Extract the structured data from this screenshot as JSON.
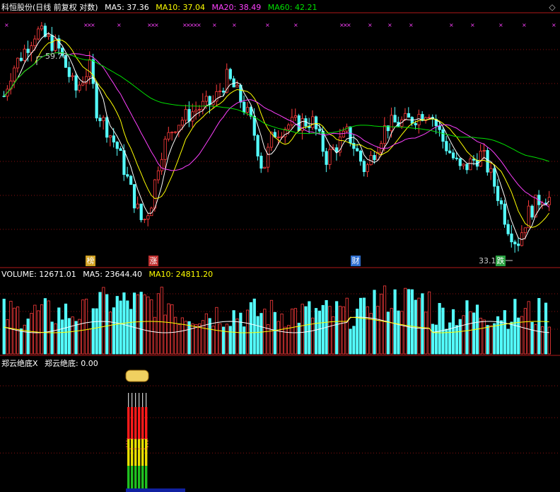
{
  "header": {
    "title": "科恒股份(日线 前复权 对数)",
    "ma5_label": "MA5: 37.36",
    "ma10_label": "MA10: 37.04",
    "ma20_label": "MA20: 38.49",
    "ma60_label": "MA60: 42.21"
  },
  "volume_header": {
    "volume_label": "VOLUME: 12671.01",
    "ma5_label": "MA5: 23644.40",
    "ma10_label": "MA10: 24811.20"
  },
  "indicator_header": {
    "name_label": "郑云绝底X",
    "value_label": "郑云绝底: 0.00"
  },
  "annotations": {
    "high_label": "59.70",
    "low_label": "33.10"
  },
  "events": [
    {
      "label": "榜",
      "color": "#d0a020"
    },
    {
      "label": "涨",
      "color": "#c03030"
    },
    {
      "label": "财",
      "color": "#2f6fd0"
    },
    {
      "label": "跌",
      "color": "#28a040"
    }
  ],
  "colors": {
    "up": "#ff3c3c",
    "down": "#54ffff",
    "ma5": "#ffffff",
    "ma10": "#ffff00",
    "ma20": "#ff40ff",
    "ma60": "#00e000",
    "grid": "#8a1010"
  },
  "chart_data": {
    "type": "candlestick",
    "title": "科恒股份(日线 前复权 对数)",
    "scale": "log",
    "price_high": 59.7,
    "price_low": 33.1,
    "ma_last": {
      "MA5": 37.36,
      "MA10": 37.04,
      "MA20": 38.49,
      "MA60": 42.21
    },
    "volume_last": {
      "VOLUME": 12671.01,
      "MA5": 23644.4,
      "MA10": 24811.2
    },
    "indicator_last": {
      "郑云绝底": 0.0
    }
  }
}
